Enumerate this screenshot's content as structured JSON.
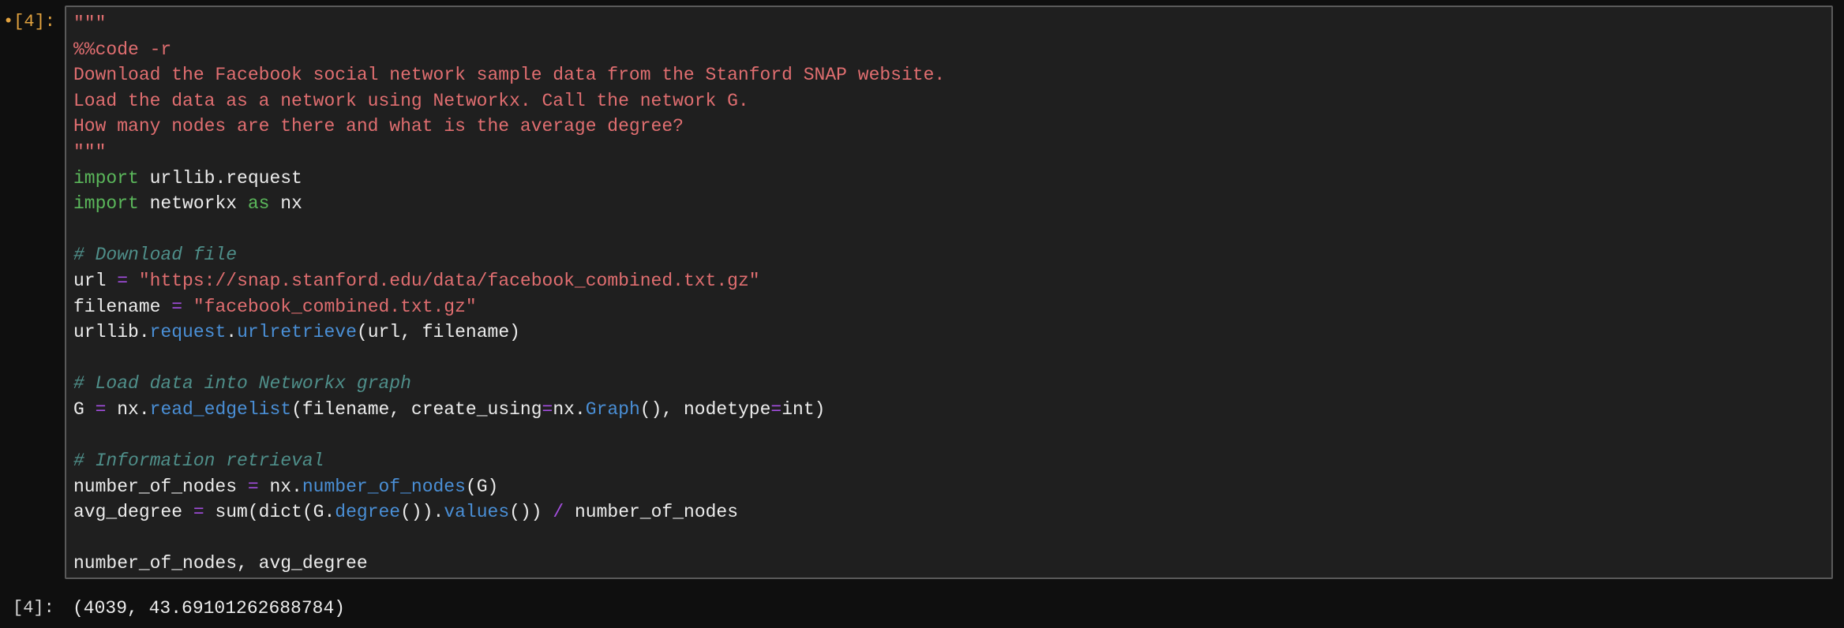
{
  "cell": {
    "input_prompt": "•[4]:",
    "lines": [
      [
        [
          "str",
          "\"\"\""
        ]
      ],
      [
        [
          "str",
          "%%code -r"
        ]
      ],
      [
        [
          "str",
          "Download the Facebook social network sample data from the Stanford SNAP website."
        ]
      ],
      [
        [
          "str",
          "Load the data as a network using Networkx. Call the network G."
        ]
      ],
      [
        [
          "str",
          "How many nodes are there and what is the average degree?"
        ]
      ],
      [
        [
          "str",
          "\"\"\""
        ]
      ],
      [
        [
          "kw",
          "import"
        ],
        [
          "tx",
          " urllib.request"
        ]
      ],
      [
        [
          "kw",
          "import"
        ],
        [
          "tx",
          " networkx "
        ],
        [
          "kw",
          "as"
        ],
        [
          "tx",
          " nx"
        ]
      ],
      [],
      [
        [
          "cm",
          "# Download file"
        ]
      ],
      [
        [
          "tx",
          "url "
        ],
        [
          "op",
          "="
        ],
        [
          "tx",
          " "
        ],
        [
          "str",
          "\"https://snap.stanford.edu/data/facebook_combined.txt.gz\""
        ]
      ],
      [
        [
          "tx",
          "filename "
        ],
        [
          "op",
          "="
        ],
        [
          "tx",
          " "
        ],
        [
          "str",
          "\"facebook_combined.txt.gz\""
        ]
      ],
      [
        [
          "tx",
          "urllib."
        ],
        [
          "fn",
          "request"
        ],
        [
          "tx",
          "."
        ],
        [
          "fn",
          "urlretrieve"
        ],
        [
          "tx",
          "(url, filename)"
        ]
      ],
      [],
      [
        [
          "cm",
          "# Load data into Networkx graph"
        ]
      ],
      [
        [
          "tx",
          "G "
        ],
        [
          "op",
          "="
        ],
        [
          "tx",
          " nx."
        ],
        [
          "fn",
          "read_edgelist"
        ],
        [
          "tx",
          "(filename, create_using"
        ],
        [
          "op",
          "="
        ],
        [
          "tx",
          "nx."
        ],
        [
          "fn",
          "Graph"
        ],
        [
          "tx",
          "(), nodetype"
        ],
        [
          "op",
          "="
        ],
        [
          "tx",
          "int)"
        ]
      ],
      [],
      [
        [
          "cm",
          "# Information retrieval"
        ]
      ],
      [
        [
          "tx",
          "number_of_nodes "
        ],
        [
          "op",
          "="
        ],
        [
          "tx",
          " nx."
        ],
        [
          "fn",
          "number_of_nodes"
        ],
        [
          "tx",
          "(G)"
        ]
      ],
      [
        [
          "tx",
          "avg_degree "
        ],
        [
          "op",
          "="
        ],
        [
          "tx",
          " sum(dict(G."
        ],
        [
          "fn",
          "degree"
        ],
        [
          "tx",
          "())."
        ],
        [
          "fn",
          "values"
        ],
        [
          "tx",
          "()) "
        ],
        [
          "op",
          "/"
        ],
        [
          "tx",
          " number_of_nodes"
        ]
      ],
      [],
      [
        [
          "tx",
          "number_of_nodes, avg_degree"
        ]
      ]
    ]
  },
  "output": {
    "prompt": "[4]:",
    "value": "(4039, 43.69101262688784)"
  },
  "colors": {
    "string": "#e06e70",
    "keyword": "#5bb85b",
    "comment": "#4f8f8a",
    "function": "#4a8fd6",
    "operator": "#a44ee0",
    "prompt": "#e3a33f"
  }
}
